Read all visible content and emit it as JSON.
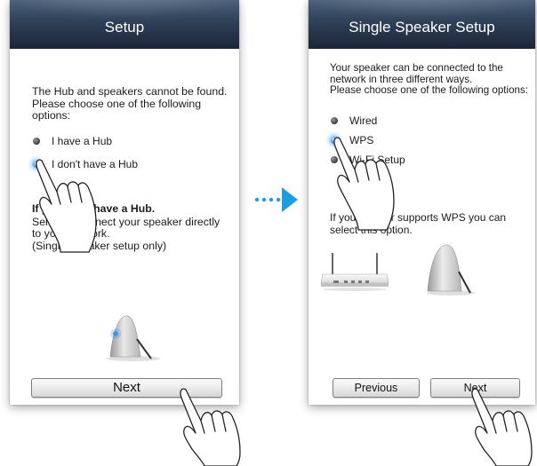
{
  "left_screen": {
    "title": "Setup",
    "intro_lines": [
      "The Hub and speakers cannot be found.",
      "Please choose one of the following",
      "options:"
    ],
    "options": [
      {
        "label": "I have a Hub",
        "selected": false
      },
      {
        "label": "I don't have a Hub",
        "selected": true
      }
    ],
    "note_heading": "If you don't have a Hub.",
    "note_lines": [
      "Select to connect your speaker directly",
      "to your network.",
      "(Single Speaker setup only)"
    ],
    "next_button": "Next"
  },
  "right_screen": {
    "title": "Single Speaker Setup",
    "intro_lines": [
      "Your speaker can be connected to the",
      "network in three different ways.",
      "Please choose one of the following options:"
    ],
    "options": [
      {
        "label": "Wired",
        "selected": false
      },
      {
        "label": "WPS",
        "selected": true
      },
      {
        "label": "Wi-Fi Setup",
        "selected": false
      }
    ],
    "info_lines": [
      "If your Router supports WPS you can",
      "select this option."
    ],
    "previous_button": "Previous",
    "next_button": "Next"
  },
  "icons": {
    "hand_pointer": "hand-pointer-icon",
    "transition_arrow": "dotted-arrow-right-icon",
    "speaker": "speaker-icon",
    "router": "router-icon"
  },
  "colors": {
    "header_top": "#4a5f79",
    "header_bottom": "#1b2637",
    "selected_radio": "#3c93e0",
    "arrow": "#1a9fe0"
  }
}
